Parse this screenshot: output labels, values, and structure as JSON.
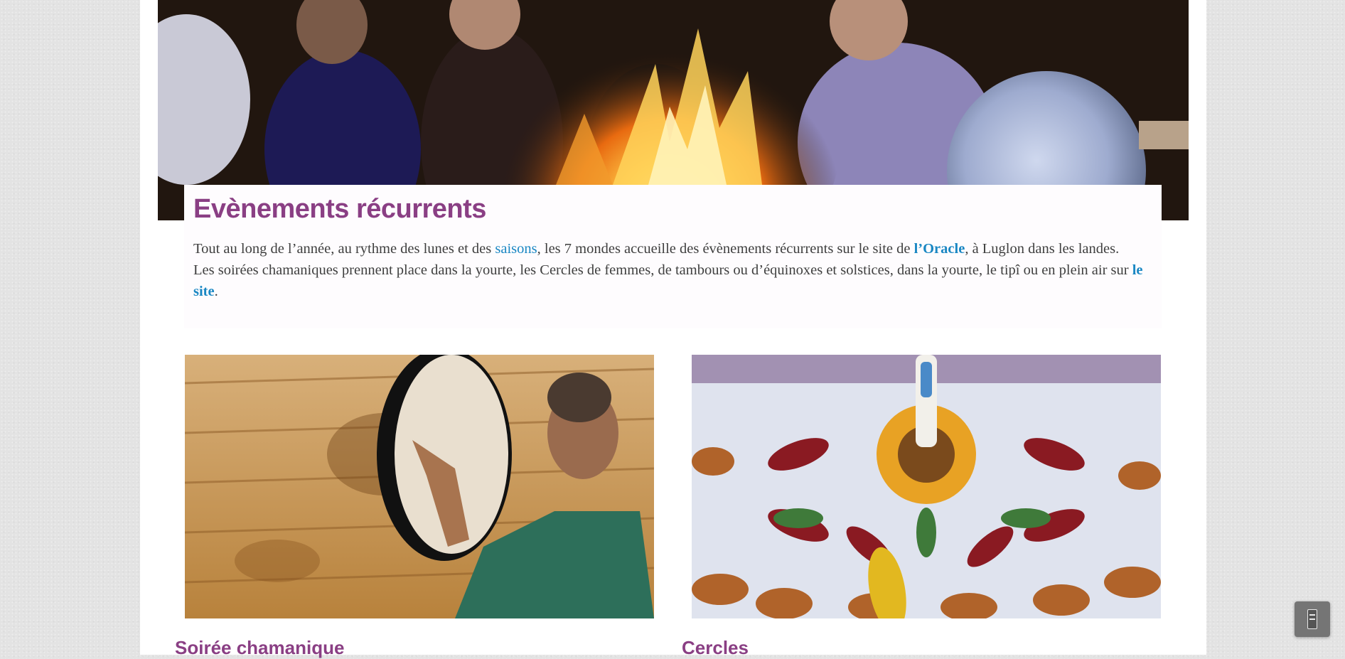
{
  "hero": {
    "image": "campfire-circle-photo"
  },
  "intro": {
    "title": "Evènements récurrents",
    "p1": "Tout au long de l’année, au rythme des lunes et des ",
    "link_saisons": "saisons",
    "p2": ", les 7 mondes accueille des évènements récurrents sur le site de ",
    "link_oracle": "l’Oracle",
    "p3": ", à Luglon dans les landes.",
    "p4": "Les soirées chamaniques prennent place dans la yourte, les Cercles de femmes, de tambours ou d’équinoxes et solstices, dans la yourte, le tipî ou en plein air sur ",
    "link_site": "le site",
    "p5": "."
  },
  "cards": [
    {
      "title": "Soirée chamanique",
      "image": "woman-with-frame-drum-photo"
    },
    {
      "title": "Cercles",
      "image": "leaf-mandala-with-virgin-statue-photo"
    }
  ],
  "widget": {
    "icon": "phone-icon"
  },
  "colors": {
    "heading": "#8a3f84",
    "link": "#1a87c3",
    "text": "#3f3f3f",
    "background": "#e3e3e3"
  }
}
